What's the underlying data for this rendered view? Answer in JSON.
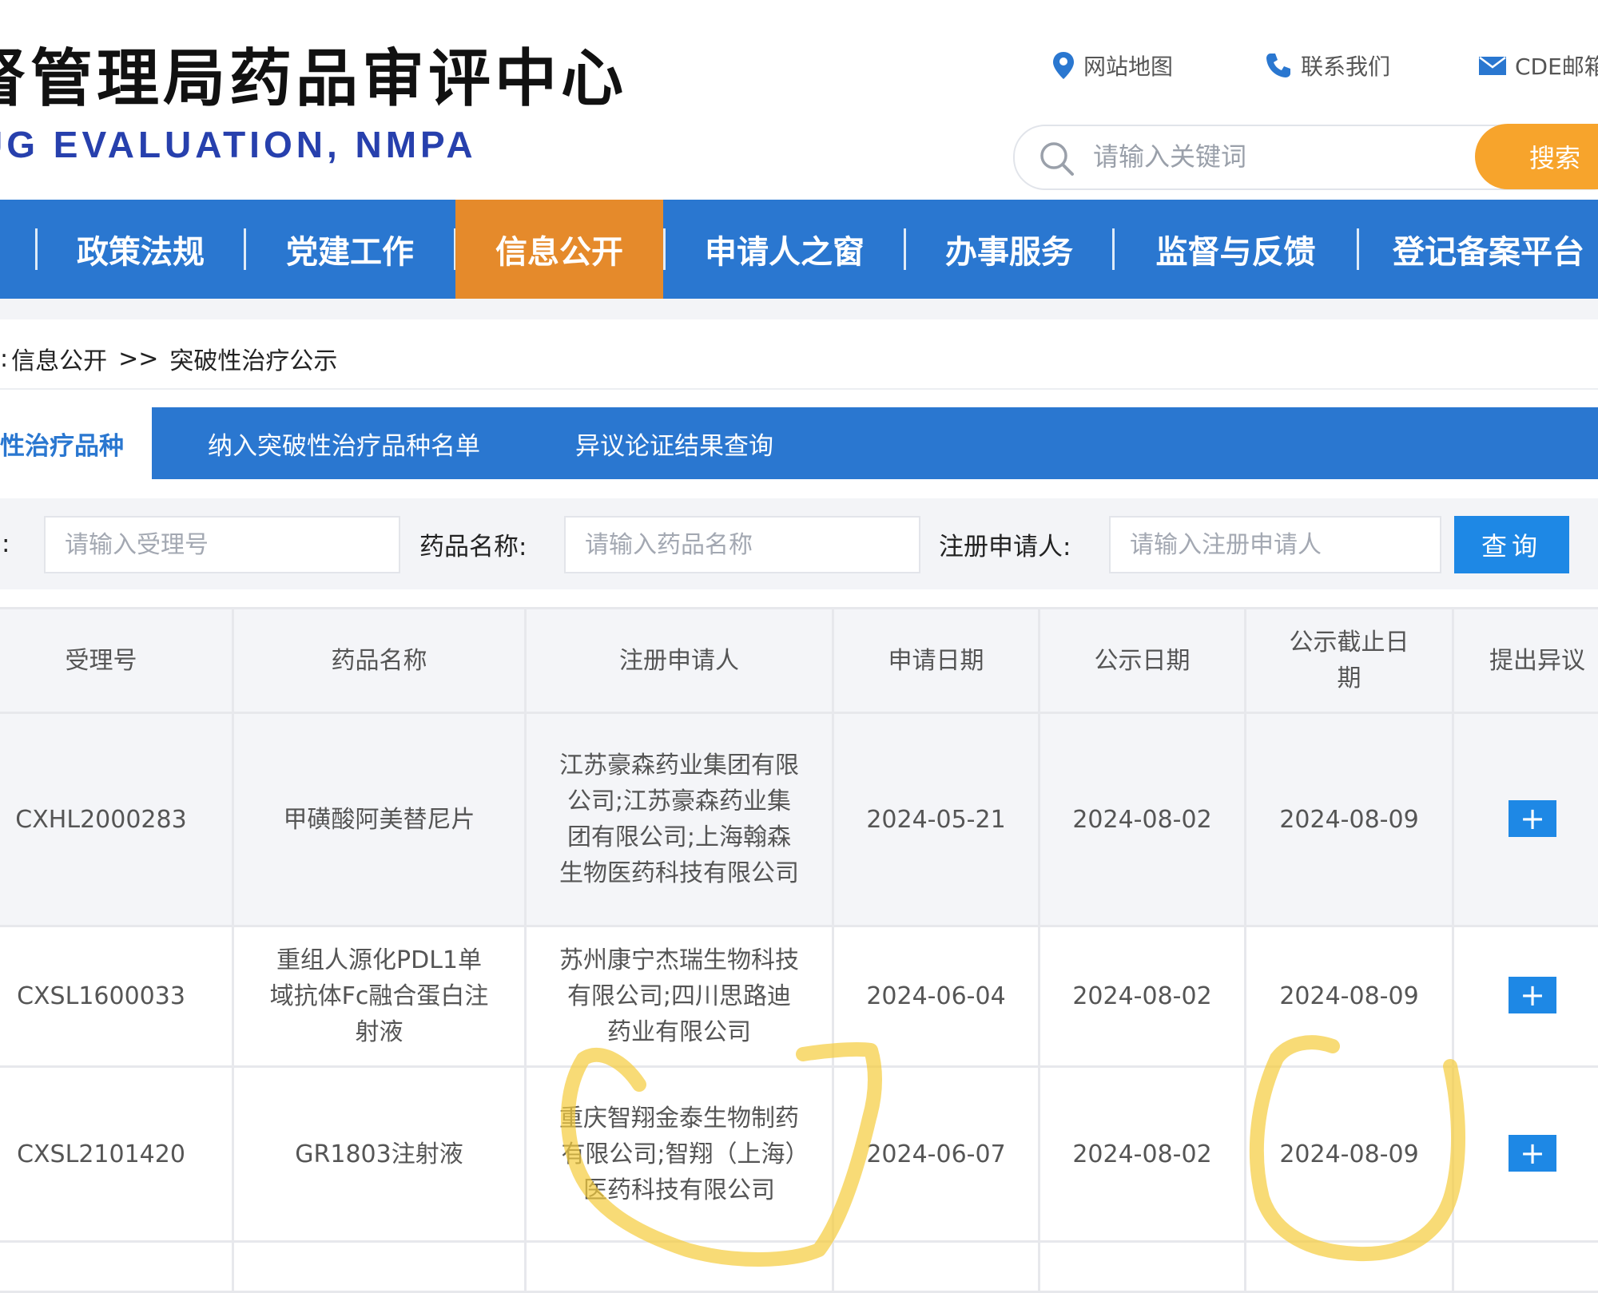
{
  "header": {
    "title": "督管理局药品审评中心",
    "subtitle": "UG EVALUATION, NMPA",
    "links": {
      "sitemap": "网站地图",
      "contact": "联系我们",
      "mail": "CDE邮箱"
    },
    "search": {
      "placeholder": "请输入关键词",
      "button": "搜索"
    }
  },
  "nav": {
    "items": [
      {
        "label": "政策法规"
      },
      {
        "label": "党建工作"
      },
      {
        "label": "信息公开"
      },
      {
        "label": "申请人之窗"
      },
      {
        "label": "办事服务"
      },
      {
        "label": "监督与反馈"
      },
      {
        "label": "登记备案平台"
      }
    ],
    "active_index": 2
  },
  "breadcrumb": {
    "prefix": ":",
    "parent": "信息公开",
    "separator": ">>",
    "current": "突破性治疗公示"
  },
  "subtabs": [
    {
      "label": "性治疗品种",
      "active": true
    },
    {
      "label": "纳入突破性治疗品种名单",
      "active": false
    },
    {
      "label": "异议论证结果查询",
      "active": false
    }
  ],
  "filters": {
    "accept_no": {
      "label": ":",
      "placeholder": "请输入受理号"
    },
    "drug_name": {
      "label": "药品名称:",
      "placeholder": "请输入药品名称"
    },
    "applicant": {
      "label": "注册申请人:",
      "placeholder": "请输入注册申请人"
    },
    "query_button": "查询"
  },
  "table": {
    "headers": [
      "受理号",
      "药品名称",
      "注册申请人",
      "申请日期",
      "公示日期",
      "公示截止日期",
      "提出异议"
    ],
    "rows": [
      {
        "accept_no": "CXHL2000283",
        "drug_name": "甲磺酸阿美替尼片",
        "applicant": "江苏豪森药业集团有限公司;江苏豪森药业集团有限公司;上海翰森生物医药科技有限公司",
        "apply_date": "2024-05-21",
        "publish_date": "2024-08-02",
        "deadline": "2024-08-09",
        "action": "+"
      },
      {
        "accept_no": "CXSL1600033",
        "drug_name": "重组人源化PDL1单域抗体Fc融合蛋白注射液",
        "applicant": "苏州康宁杰瑞生物科技有限公司;四川思路迪药业有限公司",
        "apply_date": "2024-06-04",
        "publish_date": "2024-08-02",
        "deadline": "2024-08-09",
        "action": "+"
      },
      {
        "accept_no": "CXSL2101420",
        "drug_name": "GR1803注射液",
        "applicant": "重庆智翔金泰生物制药有限公司;智翔（上海）医药科技有限公司",
        "apply_date": "2024-06-07",
        "publish_date": "2024-08-02",
        "deadline": "2024-08-09",
        "action": "+"
      }
    ]
  },
  "colors": {
    "nav_blue": "#2a77d0",
    "active_orange": "#e58a2b",
    "search_orange": "#f7a42c",
    "button_blue": "#1e88e5",
    "highlight_yellow": "#f5cc3c",
    "subtitle_blue": "#2740ad"
  },
  "icons": {
    "search": "magnifier-icon",
    "sitemap": "location-pin-icon",
    "contact": "phone-icon",
    "mail": "envelope-icon"
  }
}
